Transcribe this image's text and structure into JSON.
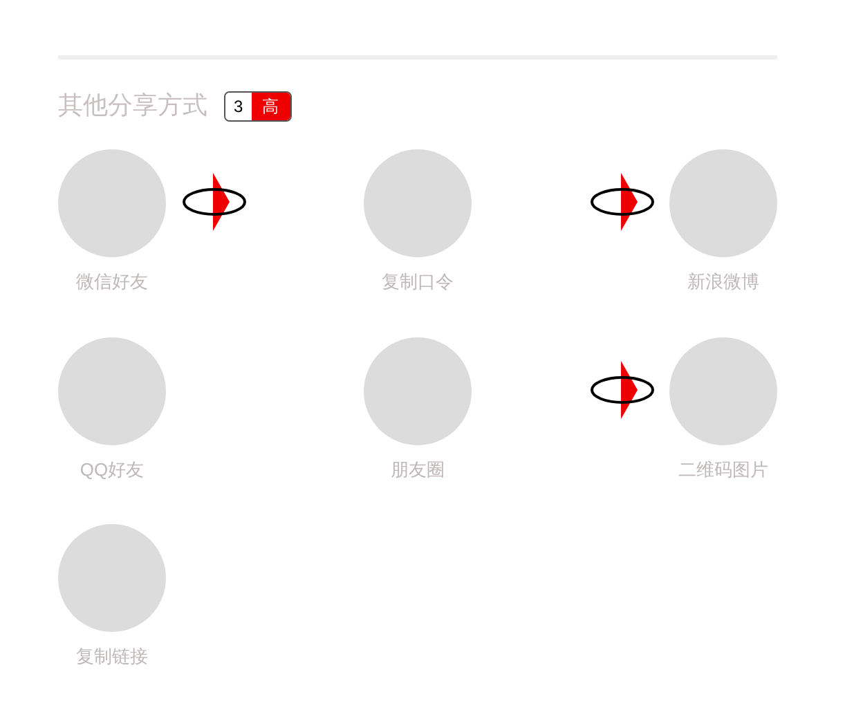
{
  "section": {
    "title": "其他分享方式",
    "badge": {
      "count": "3",
      "level_text": "高"
    }
  },
  "share_options": [
    {
      "label": "微信好友",
      "loading": true
    },
    {
      "label": "复制口令",
      "loading": false
    },
    {
      "label": "新浪微博",
      "loading": true
    },
    {
      "label": "QQ好友",
      "loading": false
    },
    {
      "label": "朋友圈",
      "loading": false
    },
    {
      "label": "二维码图片",
      "loading": true
    },
    {
      "label": "复制链接",
      "loading": false
    }
  ]
}
